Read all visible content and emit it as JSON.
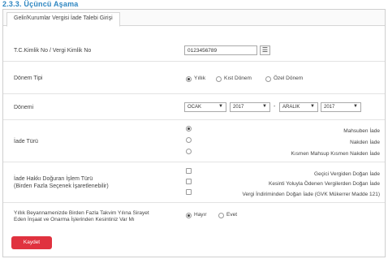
{
  "heading": "2.3.3. Üçüncü Aşama",
  "tab": {
    "label": "Gelir/Kurumlar Vergisi İade Talebi Girişi"
  },
  "tckimlik": {
    "label": "T.C.Kimlik No / Vergi Kimlik No",
    "value": "0123456789",
    "list_icon": "list-icon"
  },
  "donem_tipi": {
    "label": "Dönem Tipi",
    "options": [
      "Yıllık",
      "Kıst Dönem",
      "Özel Dönem"
    ],
    "selected": "Yıllık"
  },
  "donemi": {
    "label": "Dönemi",
    "start_month": "OCAK",
    "start_year": "2017",
    "separator": "-",
    "end_month": "ARALIK",
    "end_year": "2017"
  },
  "iade_turu": {
    "label": "İade Türü",
    "options": [
      "Mahsuben İade",
      "Nakden İade",
      "Kısmen Mahsup Kısmen Nakden İade"
    ],
    "selected": "Mahsuben İade"
  },
  "islem_turu": {
    "label_line1": "İade Hakkı Doğuran İşlem Türü",
    "label_line2": "(Birden Fazla Seçenek İşaretlenebilir)",
    "options": [
      "Geçici Vergiden Doğan İade",
      "Kesinti Yoluyla Ödenen Vergilerden Doğan İade",
      "Vergi İndiriminden Doğan İade (GVK Mükerrer Madde 121)"
    ]
  },
  "sirayet": {
    "label_line1": "Yıllık Beyannamenizde Birden Fazla Takvim Yılına Sirayet",
    "label_line2": "Eden İnşaat ve Onarma İşlerinden Kesintiniz Var Mı",
    "options": [
      "Hayır",
      "Evet"
    ],
    "selected": "Hayır"
  },
  "save_label": "Kaydet",
  "colors": {
    "heading": "#2e86c1",
    "save": "#e0323f"
  }
}
